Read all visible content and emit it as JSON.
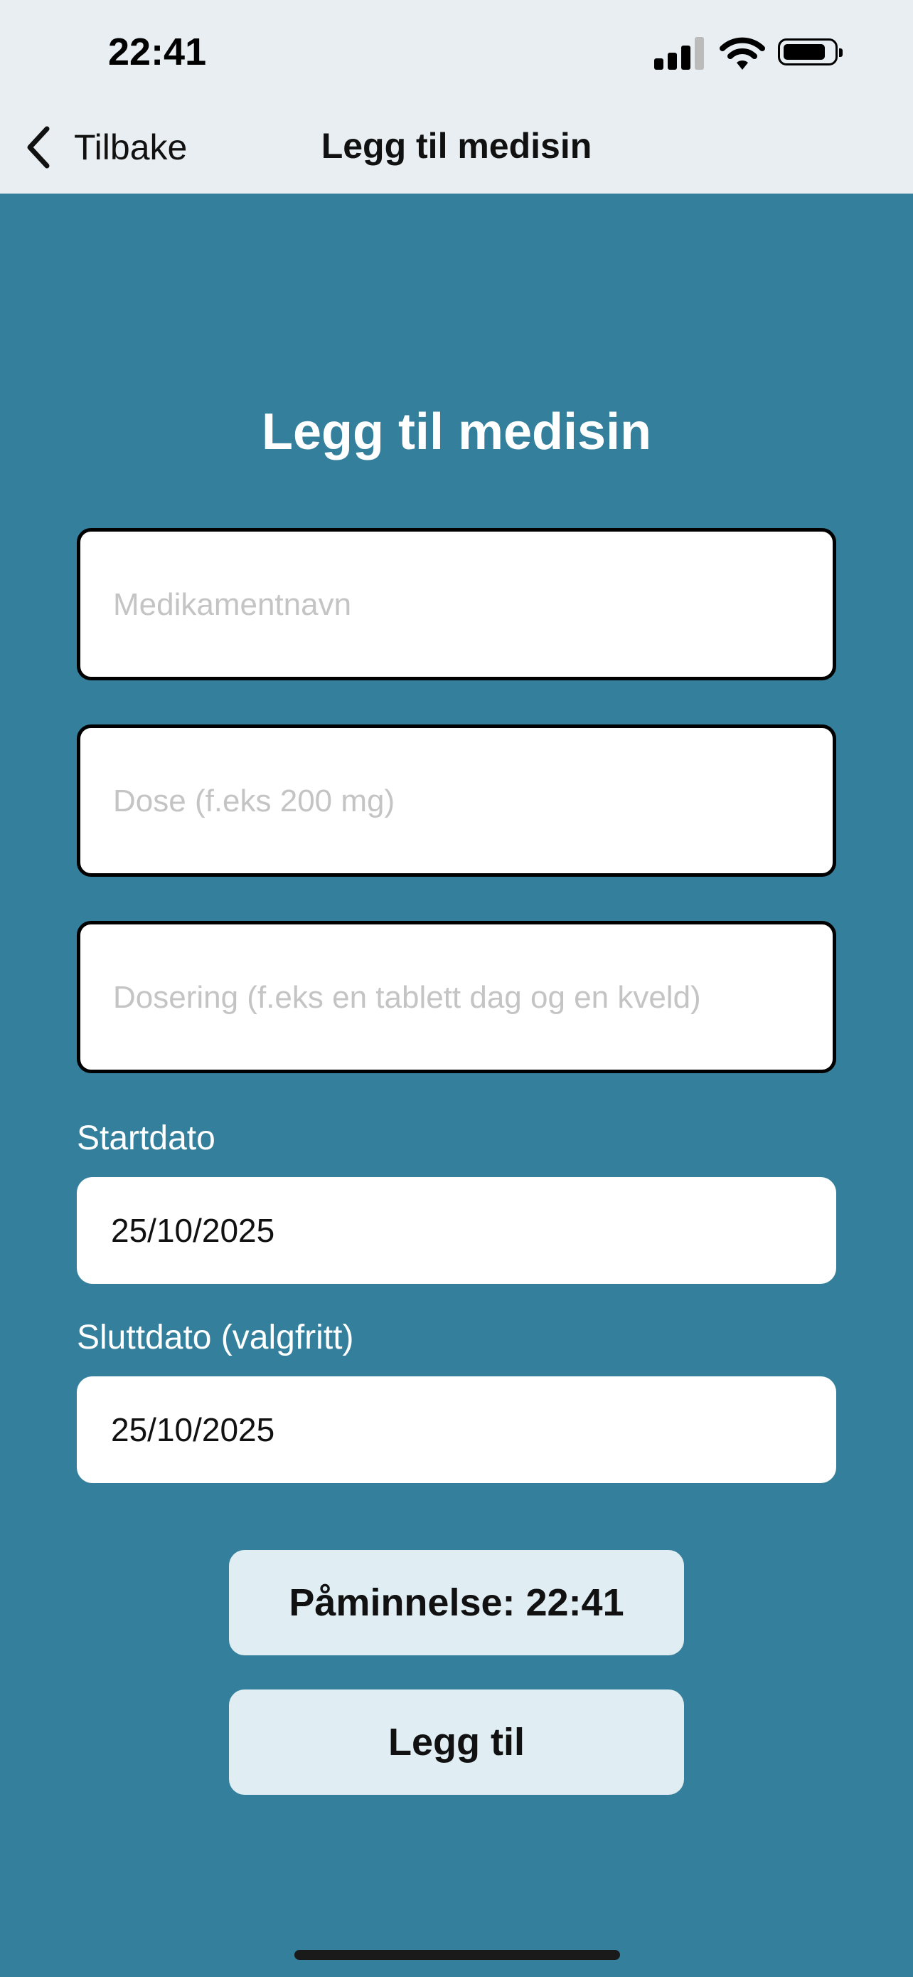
{
  "status_bar": {
    "time": "22:41",
    "icons": [
      "cellular-signal-icon",
      "wifi-icon",
      "battery-icon"
    ]
  },
  "nav": {
    "back_label": "Tilbake",
    "title": "Legg til medisin"
  },
  "form": {
    "heading": "Legg til medisin",
    "medication_name": {
      "value": "",
      "placeholder": "Medikamentnavn"
    },
    "dose": {
      "value": "",
      "placeholder": "Dose (f.eks 200 mg)"
    },
    "dosage": {
      "value": "",
      "placeholder": "Dosering (f.eks en tablett dag og en kveld)"
    },
    "start_date": {
      "label": "Startdato",
      "value": "25/10/2025"
    },
    "end_date": {
      "label": "Sluttdato (valgfritt)",
      "value": "25/10/2025"
    },
    "reminder_button": "Påminnelse: 22:41",
    "submit_button": "Legg til"
  },
  "colors": {
    "background": "#34809c",
    "header": "#e8eef1",
    "button": "#e0edf2"
  }
}
